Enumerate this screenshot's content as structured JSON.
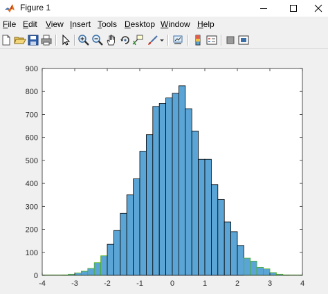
{
  "window": {
    "title": "Figure 1",
    "controls": {
      "minimize_icon": "minimize-icon",
      "maximize_icon": "maximize-icon",
      "close_icon": "close-icon"
    }
  },
  "menu": {
    "items": [
      {
        "accel": "F",
        "rest": "ile"
      },
      {
        "accel": "E",
        "rest": "dit"
      },
      {
        "accel": "V",
        "rest": "iew"
      },
      {
        "accel": "I",
        "rest": "nsert"
      },
      {
        "accel": "T",
        "rest": "ools"
      },
      {
        "accel": "D",
        "rest": "esktop"
      },
      {
        "accel": "W",
        "rest": "indow"
      },
      {
        "accel": "H",
        "rest": "elp"
      }
    ]
  },
  "toolbar": {
    "buttons": [
      "new-figure-icon",
      "open-file-icon",
      "save-icon",
      "print-icon",
      "edit-plot-pointer-icon",
      "zoom-in-icon",
      "zoom-out-icon",
      "pan-hand-icon",
      "rotate-3d-icon",
      "data-cursor-icon",
      "brush-icon",
      "brush-dropdown-icon",
      "link-plot-icon",
      "insert-colorbar-icon",
      "insert-legend-icon",
      "hide-plot-tools-icon",
      "show-plot-tools-icon"
    ]
  },
  "colors": {
    "bar_fill": "#5aa5d6",
    "bar_edge": "#000000",
    "bar_edge_green": "#4caf1f",
    "axes_bg": "#ffffff",
    "axes_line": "#262626",
    "figure_bg": "#f0f0f0"
  },
  "chart_data": {
    "type": "bar",
    "subtype": "histogram",
    "title": "",
    "xlabel": "",
    "ylabel": "",
    "xlim": [
      -4,
      4
    ],
    "ylim": [
      0,
      900
    ],
    "xticks": [
      "-4",
      "-3",
      "-2",
      "-1",
      "0",
      "1",
      "2",
      "3",
      "4"
    ],
    "yticks": [
      "0",
      "100",
      "200",
      "300",
      "400",
      "500",
      "600",
      "700",
      "800",
      "900"
    ],
    "grid": false,
    "legend": "none",
    "bin_width": 0.2,
    "bins": [
      {
        "x0": -3.4,
        "x1": -3.2,
        "value": 2
      },
      {
        "x0": -3.2,
        "x1": -3.0,
        "value": 5
      },
      {
        "x0": -3.0,
        "x1": -2.8,
        "value": 10
      },
      {
        "x0": -2.8,
        "x1": -2.6,
        "value": 18
      },
      {
        "x0": -2.6,
        "x1": -2.4,
        "value": 30
      },
      {
        "x0": -2.4,
        "x1": -2.2,
        "value": 55
      },
      {
        "x0": -2.2,
        "x1": -2.0,
        "value": 85
      },
      {
        "x0": -2.0,
        "x1": -1.8,
        "value": 135
      },
      {
        "x0": -1.8,
        "x1": -1.6,
        "value": 195
      },
      {
        "x0": -1.6,
        "x1": -1.4,
        "value": 270
      },
      {
        "x0": -1.4,
        "x1": -1.2,
        "value": 350
      },
      {
        "x0": -1.2,
        "x1": -1.0,
        "value": 420
      },
      {
        "x0": -1.0,
        "x1": -0.8,
        "value": 540
      },
      {
        "x0": -0.8,
        "x1": -0.6,
        "value": 612
      },
      {
        "x0": -0.6,
        "x1": -0.4,
        "value": 735
      },
      {
        "x0": -0.4,
        "x1": -0.2,
        "value": 748
      },
      {
        "x0": -0.2,
        "x1": 0.0,
        "value": 772
      },
      {
        "x0": 0.0,
        "x1": 0.2,
        "value": 792
      },
      {
        "x0": 0.2,
        "x1": 0.4,
        "value": 825
      },
      {
        "x0": 0.4,
        "x1": 0.6,
        "value": 725
      },
      {
        "x0": 0.6,
        "x1": 0.8,
        "value": 628
      },
      {
        "x0": 0.8,
        "x1": 1.0,
        "value": 505
      },
      {
        "x0": 1.0,
        "x1": 1.2,
        "value": 505
      },
      {
        "x0": 1.2,
        "x1": 1.4,
        "value": 395
      },
      {
        "x0": 1.4,
        "x1": 1.6,
        "value": 330
      },
      {
        "x0": 1.6,
        "x1": 1.8,
        "value": 232
      },
      {
        "x0": 1.8,
        "x1": 2.0,
        "value": 190
      },
      {
        "x0": 2.0,
        "x1": 2.2,
        "value": 130
      },
      {
        "x0": 2.2,
        "x1": 2.4,
        "value": 75
      },
      {
        "x0": 2.4,
        "x1": 2.6,
        "value": 62
      },
      {
        "x0": 2.6,
        "x1": 2.8,
        "value": 35
      },
      {
        "x0": 2.8,
        "x1": 3.0,
        "value": 28
      },
      {
        "x0": 3.0,
        "x1": 3.2,
        "value": 12
      },
      {
        "x0": 3.2,
        "x1": 3.4,
        "value": 5
      },
      {
        "x0": 3.4,
        "x1": 3.6,
        "value": 2
      }
    ]
  }
}
